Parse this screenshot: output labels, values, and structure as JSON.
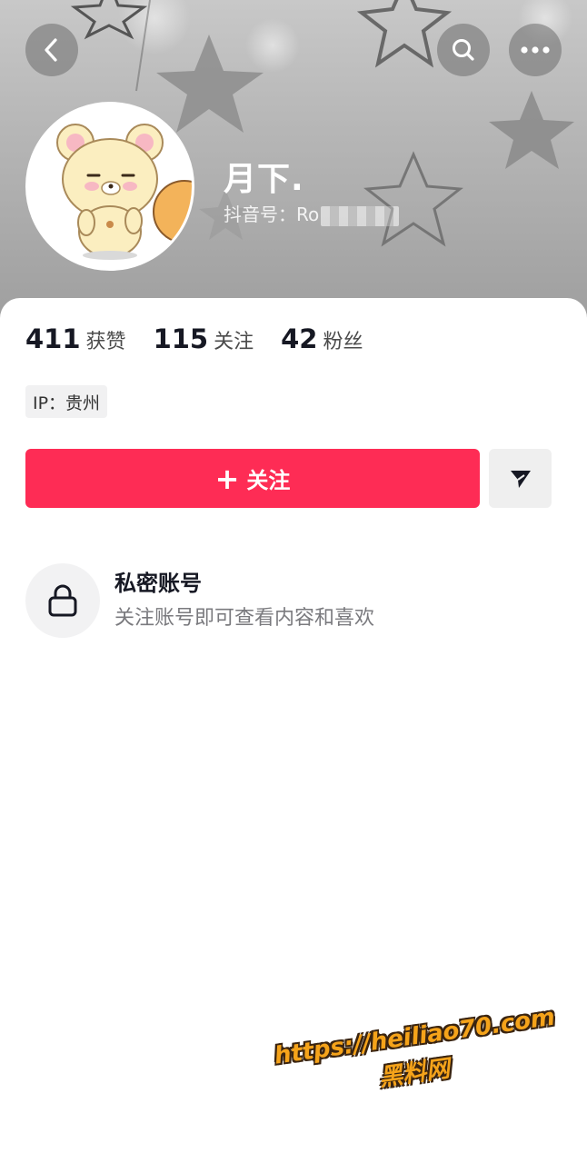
{
  "header": {
    "nickname": "月下.",
    "douyin_id_label": "抖音号：Ro"
  },
  "icons": {
    "back": "chevron-left-icon",
    "search": "search-icon",
    "more": "more-dots-icon",
    "share": "send-icon",
    "lock": "lock-icon"
  },
  "stats": [
    {
      "value": "411",
      "label": "获赞"
    },
    {
      "value": "115",
      "label": "关注"
    },
    {
      "value": "42",
      "label": "粉丝"
    }
  ],
  "ip_tag": "IP：贵州",
  "follow_button": {
    "plus": "+",
    "label": "关注"
  },
  "private_account": {
    "title": "私密账号",
    "subtitle": "关注账号即可查看内容和喜欢"
  },
  "watermark": {
    "url": "https://heiliao70.com",
    "name": "黑料网"
  },
  "colors": {
    "accent": "#fe2c55",
    "watermark": "#f5a31a"
  }
}
